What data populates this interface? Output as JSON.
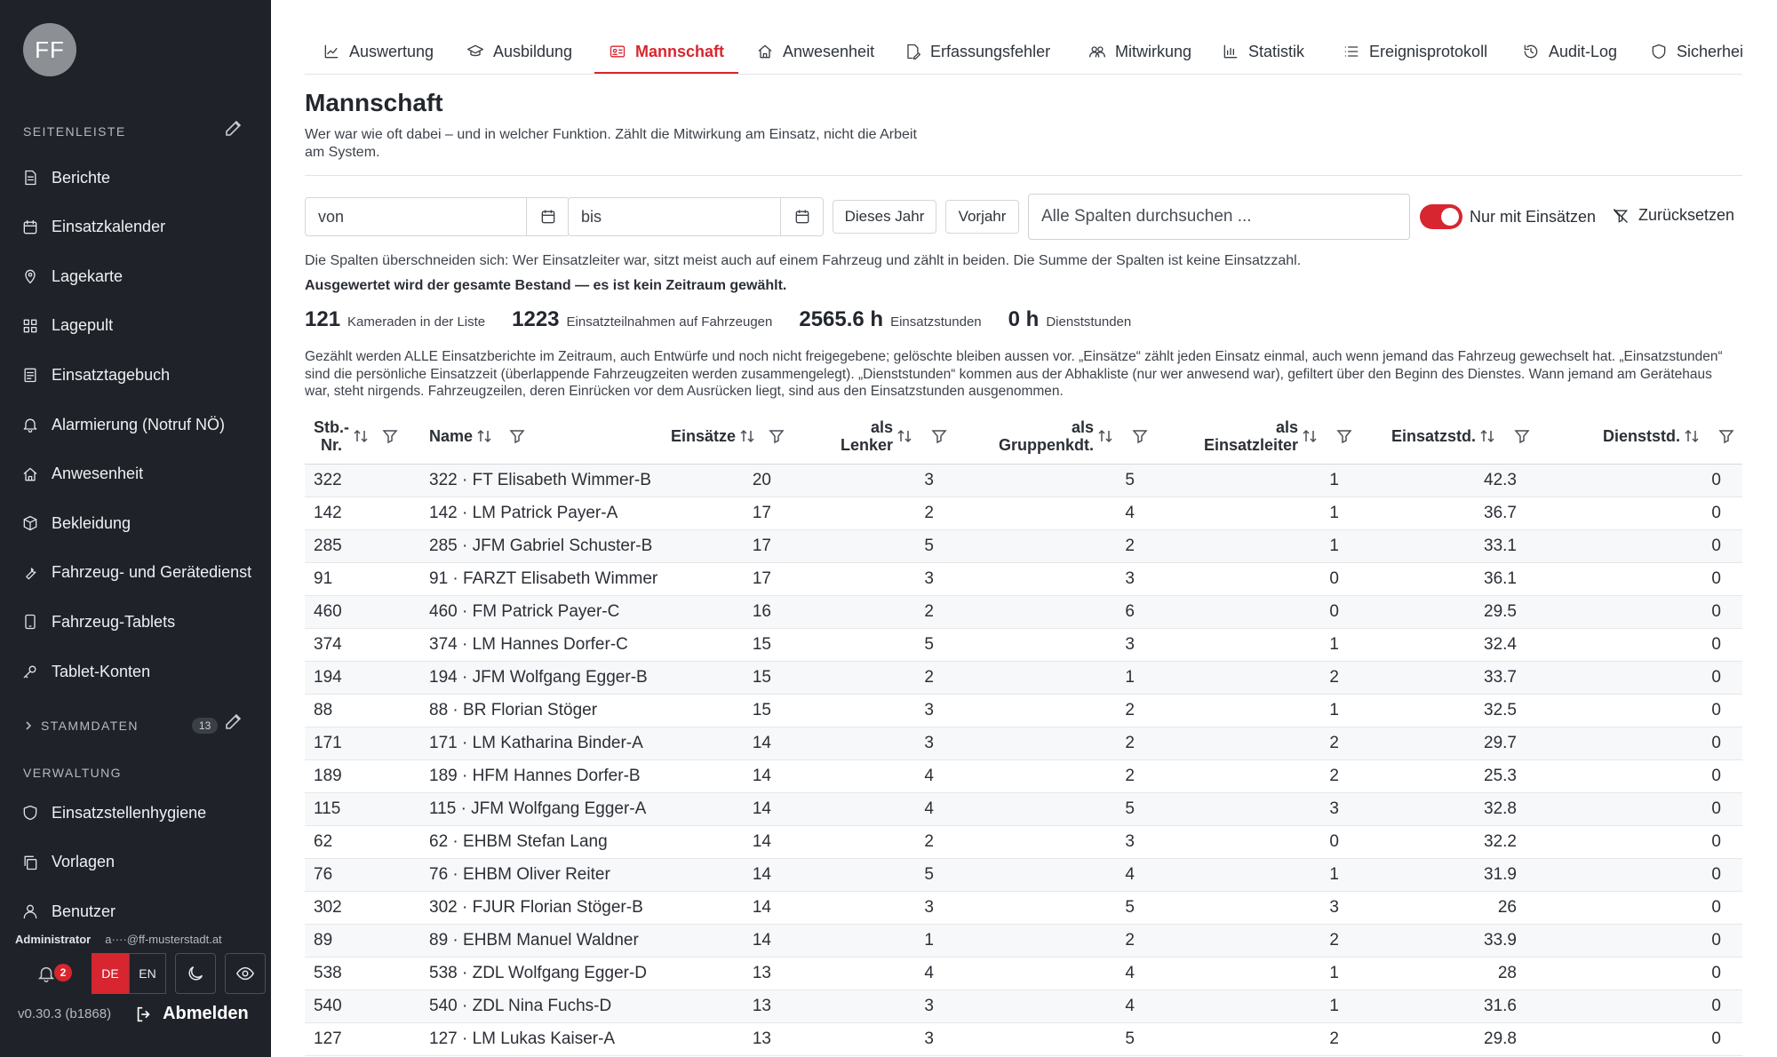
{
  "sidebar": {
    "avatar_initials": "FF",
    "section_sidebar": "SEITENLEISTE",
    "items": [
      {
        "label": "Berichte",
        "icon": "document-icon"
      },
      {
        "label": "Einsatzkalender",
        "icon": "calendar-icon"
      },
      {
        "label": "Lagekarte",
        "icon": "map-pin-icon"
      },
      {
        "label": "Lagepult",
        "icon": "grid-icon"
      },
      {
        "label": "Einsatztagebuch",
        "icon": "journal-icon"
      },
      {
        "label": "Alarmierung (Notruf NÖ)",
        "icon": "bell-icon"
      },
      {
        "label": "Anwesenheit",
        "icon": "house-icon"
      },
      {
        "label": "Bekleidung",
        "icon": "box-icon"
      },
      {
        "label": "Fahrzeug- und Gerätedienst",
        "icon": "wrench-icon"
      },
      {
        "label": "Fahrzeug-Tablets",
        "icon": "tablet-icon"
      },
      {
        "label": "Tablet-Konten",
        "icon": "key-icon"
      }
    ],
    "section_stammdaten": "STAMMDATEN",
    "stammdaten_count": "13",
    "section_verwaltung": "VERWALTUNG",
    "admin_items": [
      {
        "label": "Einsatzstellenhygiene",
        "icon": "shield-icon"
      },
      {
        "label": "Vorlagen",
        "icon": "copy-icon"
      },
      {
        "label": "Benutzer",
        "icon": "users-icon"
      }
    ],
    "user_role": "Administrator",
    "user_email": "a····@ff-musterstadt.at",
    "notification_count": "2",
    "lang_de": "DE",
    "lang_en": "EN",
    "version": "v0.30.3 (b1868)",
    "logout": "Abmelden"
  },
  "tabs": [
    {
      "label": "Auswertung",
      "icon": "chart-line-icon"
    },
    {
      "label": "Ausbildung",
      "icon": "graduation-cap-icon"
    },
    {
      "label": "Mannschaft",
      "icon": "id-card-icon"
    },
    {
      "label": "Anwesenheit",
      "icon": "house-icon"
    },
    {
      "label": "Erfassungsfehler",
      "icon": "edit-document-icon"
    },
    {
      "label": "Mitwirkung",
      "icon": "people-icon"
    },
    {
      "label": "Statistik",
      "icon": "bar-chart-icon"
    },
    {
      "label": "Ereignisprotokoll",
      "icon": "list-icon"
    },
    {
      "label": "Audit-Log",
      "icon": "history-icon"
    },
    {
      "label": "Sicherheit",
      "icon": "shield-icon"
    }
  ],
  "page": {
    "title": "Mannschaft",
    "description": "Wer war wie oft dabei – und in welcher Funktion. Zählt die Mitwirkung am Einsatz, nicht die Arbeit am System."
  },
  "filters": {
    "from_placeholder": "von",
    "to_placeholder": "bis",
    "this_year": "Dieses Jahr",
    "prev_year": "Vorjahr",
    "search_placeholder": "Alle Spalten durchsuchen ...",
    "only_with_missions": "Nur mit Einsätzen",
    "reset": "Zurücksetzen"
  },
  "info": {
    "overlap_note": "Die Spalten überschneiden sich: Wer Einsatzleiter war, sitzt meist auch auf einem Fahrzeug und zählt in beiden. Die Summe der Spalten ist keine Einsatzzahl.",
    "period_note": "Ausgewertet wird der gesamte Bestand — es ist kein Zeitraum gewählt.",
    "notes": "Gezählt werden ALLE Einsatzberichte im Zeitraum, auch Entwürfe und noch nicht freigegebene; gelöschte bleiben aussen vor. „Einsätze“ zählt jeden Einsatz einmal, auch wenn jemand das Fahrzeug gewechselt hat. „Einsatzstunden“ sind die persönliche Einsatzzeit (überlappende Fahrzeugzeiten werden zusammengelegt). „Dienststunden“ kommen aus der Abhakliste (nur wer anwesend war), gefiltert über den Beginn des Dienstes. Wann jemand am Gerätehaus war, steht nirgends. Fahrzeugzeilen, deren Einrücken vor dem Ausrücken liegt, sind aus den Einsatzstunden ausgenommen."
  },
  "stats": [
    {
      "num": "121",
      "label": "Kameraden in der Liste"
    },
    {
      "num": "1223",
      "label": "Einsatzteilnahmen auf Fahrzeugen"
    },
    {
      "num": "2565.6 h",
      "label": "Einsatzstunden"
    },
    {
      "num": "0 h",
      "label": "Dienststunden"
    }
  ],
  "table": {
    "headers": [
      {
        "line1": "Stb.-",
        "line2": "Nr."
      },
      {
        "line1": "Name",
        "line2": ""
      },
      {
        "line1": "Einsätze",
        "line2": ""
      },
      {
        "line1": "als",
        "line2": "Lenker"
      },
      {
        "line1": "als",
        "line2": "Gruppenkdt."
      },
      {
        "line1": "als",
        "line2": "Einsatzleiter"
      },
      {
        "line1": "Einsatzstd.",
        "line2": ""
      },
      {
        "line1": "Dienststd.",
        "line2": ""
      }
    ],
    "rows": [
      [
        "322",
        "322 · FT Elisabeth Wimmer-B",
        "20",
        "3",
        "5",
        "1",
        "42.3",
        "0"
      ],
      [
        "142",
        "142 · LM Patrick Payer-A",
        "17",
        "2",
        "4",
        "1",
        "36.7",
        "0"
      ],
      [
        "285",
        "285 · JFM Gabriel Schuster-B",
        "17",
        "5",
        "2",
        "1",
        "33.1",
        "0"
      ],
      [
        "91",
        "91 · FARZT Elisabeth Wimmer",
        "17",
        "3",
        "3",
        "0",
        "36.1",
        "0"
      ],
      [
        "460",
        "460 · FM Patrick Payer-C",
        "16",
        "2",
        "6",
        "0",
        "29.5",
        "0"
      ],
      [
        "374",
        "374 · LM Hannes Dorfer-C",
        "15",
        "5",
        "3",
        "1",
        "32.4",
        "0"
      ],
      [
        "194",
        "194 · JFM Wolfgang Egger-B",
        "15",
        "2",
        "1",
        "2",
        "33.7",
        "0"
      ],
      [
        "88",
        "88 · BR Florian Stöger",
        "15",
        "3",
        "2",
        "1",
        "32.5",
        "0"
      ],
      [
        "171",
        "171 · LM Katharina Binder-A",
        "14",
        "3",
        "2",
        "2",
        "29.7",
        "0"
      ],
      [
        "189",
        "189 · HFM Hannes Dorfer-B",
        "14",
        "4",
        "2",
        "2",
        "25.3",
        "0"
      ],
      [
        "115",
        "115 · JFM Wolfgang Egger-A",
        "14",
        "4",
        "5",
        "3",
        "32.8",
        "0"
      ],
      [
        "62",
        "62 · EHBM Stefan Lang",
        "14",
        "2",
        "3",
        "0",
        "32.2",
        "0"
      ],
      [
        "76",
        "76 · EHBM Oliver Reiter",
        "14",
        "5",
        "4",
        "1",
        "31.9",
        "0"
      ],
      [
        "302",
        "302 · FJUR Florian Stöger-B",
        "14",
        "3",
        "5",
        "3",
        "26",
        "0"
      ],
      [
        "89",
        "89 · EHBM Manuel Waldner",
        "14",
        "1",
        "2",
        "2",
        "33.9",
        "0"
      ],
      [
        "538",
        "538 · ZDL Wolfgang Egger-D",
        "13",
        "4",
        "4",
        "1",
        "28",
        "0"
      ],
      [
        "540",
        "540 · ZDL Nina Fuchs-D",
        "13",
        "3",
        "4",
        "1",
        "31.6",
        "0"
      ],
      [
        "127",
        "127 · LM Lukas Kaiser-A",
        "13",
        "3",
        "5",
        "2",
        "29.8",
        "0"
      ]
    ]
  },
  "colors": {
    "accent": "#d7262f",
    "sidebar_bg": "#1f2329"
  }
}
